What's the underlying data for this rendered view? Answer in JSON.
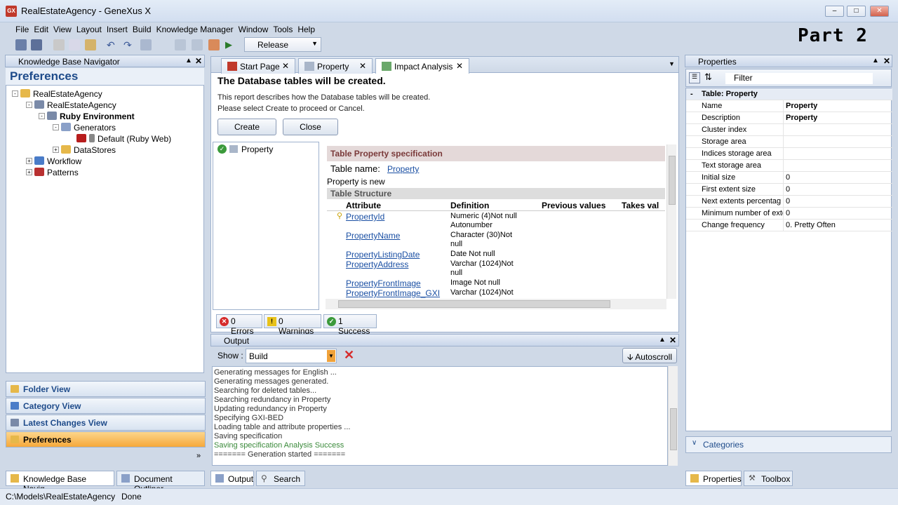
{
  "window": {
    "title": "RealEstateAgency - GeneXus X",
    "app_icon": "GX"
  },
  "annotation": "Part 2",
  "menu": [
    "File",
    "Edit",
    "View",
    "Layout",
    "Insert",
    "Build",
    "Knowledge Manager",
    "Window",
    "Tools",
    "Help"
  ],
  "toolbar": {
    "config": "Release"
  },
  "kb_nav": {
    "title": "Knowledge Base Navigator",
    "section": "Preferences",
    "tree": [
      "RealEstateAgency",
      "RealEstateAgency",
      "Ruby Environment",
      "Generators",
      "Default (Ruby Web)",
      "DataStores",
      "Workflow",
      "Patterns"
    ],
    "views": [
      "Folder View",
      "Category View",
      "Latest Changes View",
      "Preferences"
    ],
    "bottom_tabs": [
      "Knowledge Base Navig...",
      "Document Outliner"
    ]
  },
  "tabs": [
    "Start Page",
    "Property",
    "Impact Analysis"
  ],
  "impact": {
    "heading": "The Database tables will be created.",
    "desc1": "This report describes how the Database tables will be created.",
    "desc2": "Please select Create to proceed or Cancel.",
    "create": "Create",
    "close": "Close",
    "left_item": "Property",
    "spec_title": "Table Property specification",
    "table_name_label": "Table name:",
    "table_name": "Property",
    "is_new": "Property is new",
    "structure": "Table Structure",
    "cols": [
      "Attribute",
      "Definition",
      "Previous values",
      "Takes val"
    ],
    "rows": [
      {
        "attr": "PropertyId",
        "def1": "Numeric (4)Not null",
        "def2": "Autonumber"
      },
      {
        "attr": "PropertyName",
        "def1": "Character (30)Not",
        "def2": "null"
      },
      {
        "attr": "PropertyListingDate",
        "def1": "Date Not null",
        "def2": ""
      },
      {
        "attr": "PropertyAddress",
        "def1": "Varchar (1024)Not",
        "def2": "null"
      },
      {
        "attr": "PropertyFrontImage",
        "def1": "Image Not null",
        "def2": ""
      },
      {
        "attr": "PropertyFrontImage_GXI",
        "def1": "Varchar (1024)Not",
        "def2": ""
      }
    ],
    "status": [
      "0 Errors",
      "0 Warnings",
      "1 Success"
    ]
  },
  "output": {
    "title": "Output",
    "show_label": "Show :",
    "show_value": "Build",
    "autoscroll": "Autoscroll",
    "lines": [
      "Generating messages for English ...",
      "Generating messages generated.",
      "Searching for deleted tables...",
      "Searching redundancy in Property",
      "Updating redundancy in Property",
      "Specifying GXI-BED",
      "Loading table and attribute properties ...",
      "Saving specification",
      "Saving specification Analysis Success",
      "======= Generation started ======="
    ],
    "tabs": [
      "Output",
      "Search"
    ]
  },
  "properties": {
    "title": "Properties",
    "filter": "Filter",
    "group": "Table: Property",
    "rows": [
      {
        "k": "Name",
        "v": "Property",
        "bold": true
      },
      {
        "k": "Description",
        "v": "Property",
        "bold": true
      },
      {
        "k": "Cluster index",
        "v": ""
      },
      {
        "k": "Storage area",
        "v": ""
      },
      {
        "k": "Indices storage area",
        "v": ""
      },
      {
        "k": "Text storage area",
        "v": ""
      },
      {
        "k": "Initial size",
        "v": "0"
      },
      {
        "k": "First extent size",
        "v": "0"
      },
      {
        "k": "Next extents percentag",
        "v": "0"
      },
      {
        "k": "Minimum number of exte",
        "v": "0"
      },
      {
        "k": "Change frequency",
        "v": "0. Pretty Often"
      }
    ],
    "categories": "Categories",
    "tabs": [
      "Properties",
      "Toolbox"
    ]
  },
  "statusbar": {
    "path": "C:\\Models\\RealEstateAgency",
    "state": "Done"
  }
}
